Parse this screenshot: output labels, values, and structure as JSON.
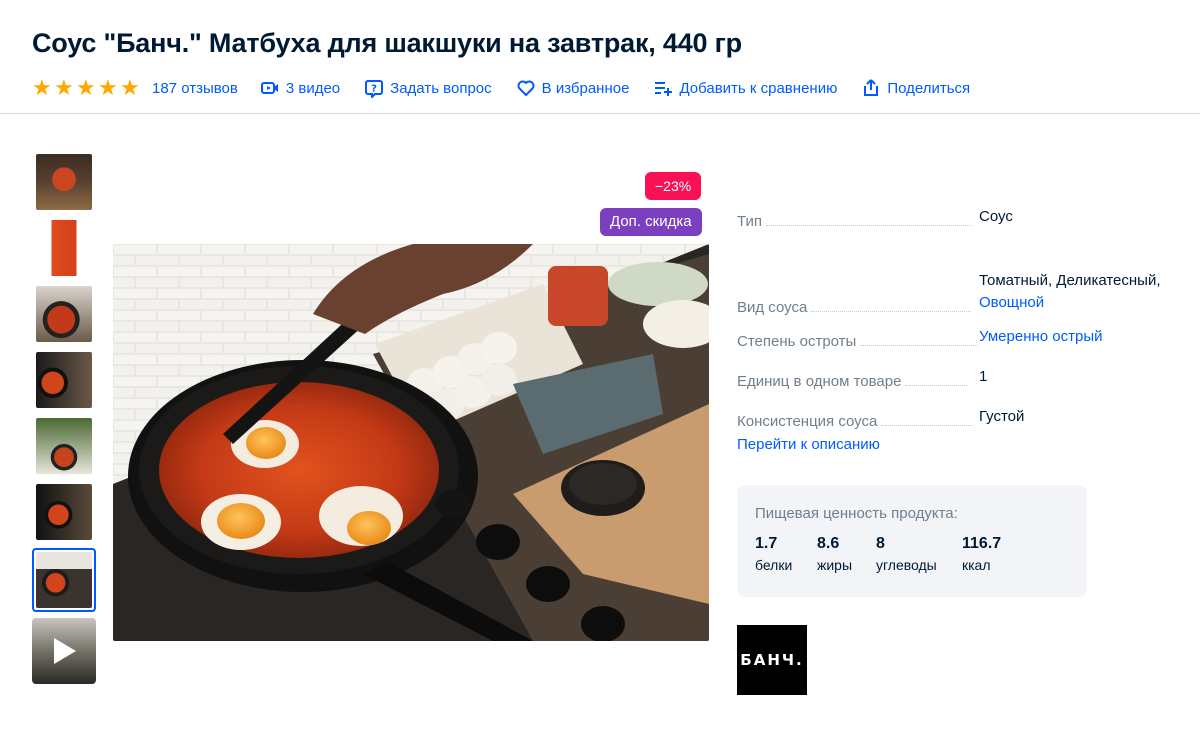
{
  "product": {
    "title": "Соус \"Банч.\" Матбуха для шакшуки на завтрак, 440 гр"
  },
  "actions": {
    "rating": 5,
    "reviews": "187 отзывов",
    "videos": "3 видео",
    "ask": "Задать вопрос",
    "favorite": "В избранное",
    "compare": "Добавить к сравнению",
    "share": "Поделиться"
  },
  "badges": {
    "discount": "−23%",
    "extra": "Доп. скидка"
  },
  "specs": [
    {
      "name": "Тип",
      "value": "Соус"
    },
    {
      "name": "Вид соуса",
      "value_plain": "Томатный, Деликатесный,",
      "value_link": "Овощной"
    },
    {
      "name": "Степень остроты",
      "value": "Умеренно острый"
    },
    {
      "name": "Единиц в одном товаре",
      "value": "1"
    },
    {
      "name": "Консистенция соуса",
      "value": "Густой"
    }
  ],
  "description_link": "Перейти к описанию",
  "nutrition": {
    "title": "Пищевая ценность продукта:",
    "items": [
      {
        "value": "1.7",
        "label": "белки"
      },
      {
        "value": "8.6",
        "label": "жиры"
      },
      {
        "value": "8",
        "label": "углеводы"
      },
      {
        "value": "116.7",
        "label": "ккал"
      }
    ]
  },
  "brand": {
    "logo_text": "БАНЧ."
  },
  "colors": {
    "accent": "#005bff",
    "discount": "#f91155",
    "extra_discount": "#7b3fbf",
    "star": "#ffa800"
  }
}
